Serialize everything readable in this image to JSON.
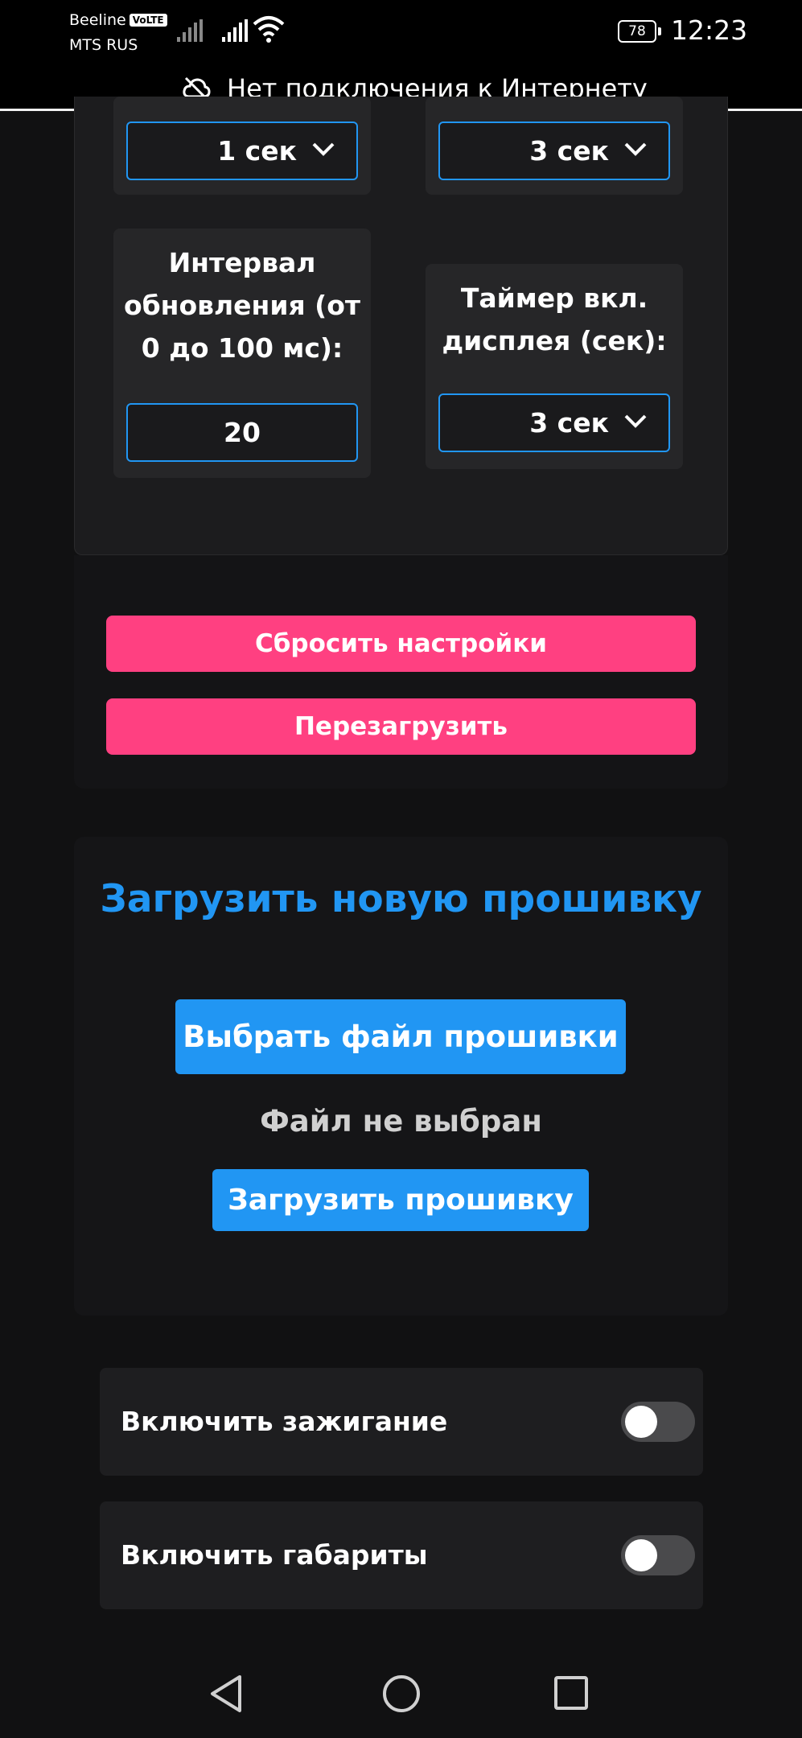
{
  "status_bar": {
    "carrier1": "Beeline",
    "volte": "VoLTE",
    "carrier2": "MTS RUS",
    "battery": "78",
    "time": "12:23"
  },
  "network_banner": {
    "text": "Нет подключения к Интернету",
    "icon": "cloud-off-icon"
  },
  "settings": {
    "select_top_left": "1 сек",
    "select_top_right": "3 сек",
    "interval": {
      "label_line1": "Интервал",
      "label_line2": "обновления (от",
      "label_line3": "0 до 100 мс):",
      "value": "20"
    },
    "display_timer": {
      "label_line1": "Таймер вкл.",
      "label_line2": "дисплея (сек):",
      "value": "3 сек"
    }
  },
  "actions": {
    "reset": "Сбросить настройки",
    "reboot": "Перезагрузить"
  },
  "firmware": {
    "title": "Загрузить новую прошивку",
    "choose_file": "Выбрать файл прошивки",
    "no_file": "Файл не выбран",
    "upload": "Загрузить прошивку"
  },
  "toggles": [
    {
      "label": "Включить зажигание",
      "on": false
    },
    {
      "label": "Включить габариты",
      "on": false
    }
  ],
  "colors": {
    "accent_blue": "#2196f3",
    "accent_pink": "#ff4081",
    "background": "#111112"
  }
}
